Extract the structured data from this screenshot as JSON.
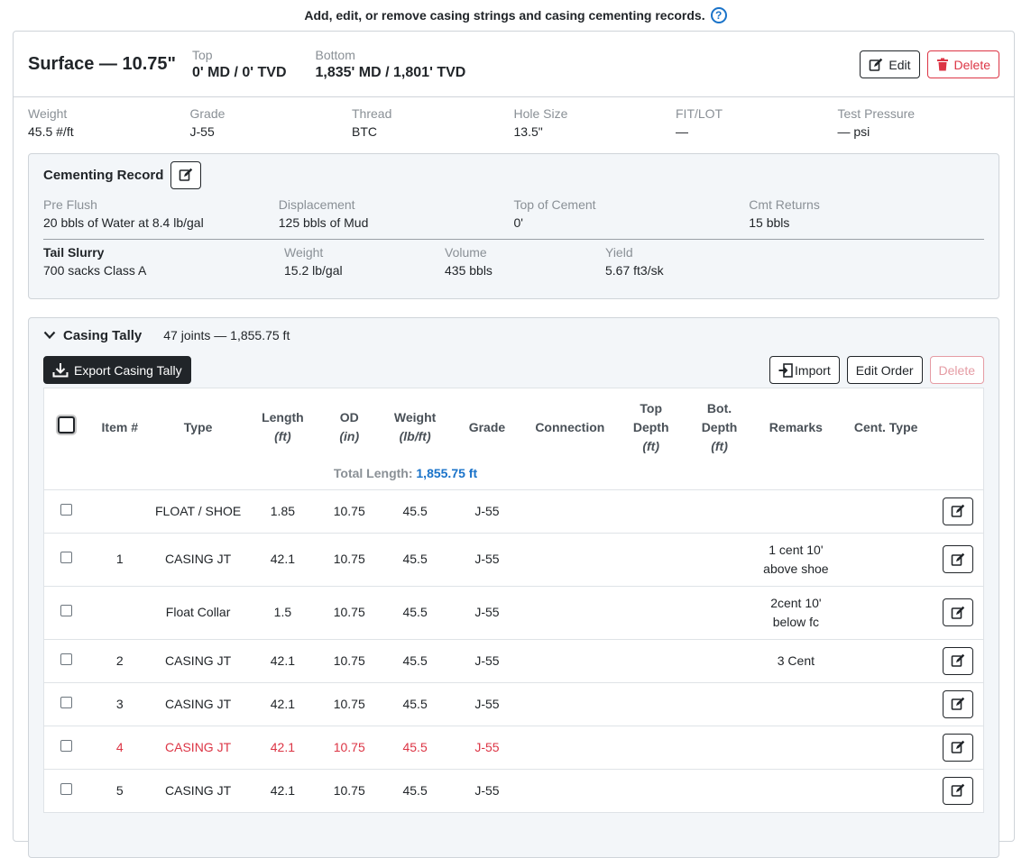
{
  "top_note": "Add, edit, or remove casing strings and casing cementing records.",
  "header": {
    "title": "Surface — 10.75\"",
    "top_label": "Top",
    "top_value": "0' MD / 0' TVD",
    "bottom_label": "Bottom",
    "bottom_value": "1,835' MD / 1,801' TVD",
    "edit_label": "Edit",
    "delete_label": "Delete"
  },
  "props": [
    {
      "label": "Weight",
      "value": "45.5 #/ft"
    },
    {
      "label": "Grade",
      "value": "J-55"
    },
    {
      "label": "Thread",
      "value": "BTC"
    },
    {
      "label": "Hole Size",
      "value": "13.5\""
    },
    {
      "label": "FIT/LOT",
      "value": "—"
    },
    {
      "label": "Test Pressure",
      "value": "— psi"
    }
  ],
  "cementing": {
    "title": "Cementing Record",
    "fields": [
      {
        "label": "Pre Flush",
        "value": "20 bbls of Water at 8.4 lb/gal"
      },
      {
        "label": "Displacement",
        "value": "125 bbls of Mud"
      },
      {
        "label": "Top of Cement",
        "value": "0'"
      },
      {
        "label": "Cmt Returns",
        "value": "15 bbls"
      }
    ],
    "tail": {
      "title": "Tail Slurry",
      "desc": "700 sacks  Class A",
      "fields": [
        {
          "label": "Weight",
          "value": "15.2 lb/gal"
        },
        {
          "label": "Volume",
          "value": "435 bbls"
        },
        {
          "label": "Yield",
          "value": "5.67 ft3/sk"
        }
      ]
    }
  },
  "tally": {
    "title": "Casing Tally",
    "summary": "47 joints — 1,855.75 ft",
    "export_label": "Export Casing Tally",
    "import_label": "Import",
    "edit_order_label": "Edit Order",
    "delete_label": "Delete",
    "columns": {
      "item": "Item #",
      "type": "Type",
      "length": "Length",
      "length_unit": "(ft)",
      "od": "OD",
      "od_unit": "(in)",
      "weight": "Weight",
      "weight_unit": "(lb/ft)",
      "grade": "Grade",
      "connection": "Connection",
      "top_depth_1": "Top",
      "top_depth_2": "Depth",
      "top_unit": "(ft)",
      "bot_depth_1": "Bot.",
      "bot_depth_2": "Depth",
      "bot_unit": "(ft)",
      "remarks": "Remarks",
      "cent_type": "Cent. Type"
    },
    "total_label": "Total Length:",
    "total_value": "1,855.75 ft",
    "rows": [
      {
        "item": "",
        "type": "FLOAT / SHOE",
        "length": "1.85",
        "od": "10.75",
        "weight": "45.5",
        "grade": "J-55",
        "remarks_1": "",
        "remarks_2": "",
        "highlight": false
      },
      {
        "item": "1",
        "type": "CASING JT",
        "length": "42.1",
        "od": "10.75",
        "weight": "45.5",
        "grade": "J-55",
        "remarks_1": "1 cent 10'",
        "remarks_2": "above shoe",
        "highlight": false
      },
      {
        "item": "",
        "type": "Float Collar",
        "length": "1.5",
        "od": "10.75",
        "weight": "45.5",
        "grade": "J-55",
        "remarks_1": "2cent 10'",
        "remarks_2": "below fc",
        "highlight": false
      },
      {
        "item": "2",
        "type": "CASING JT",
        "length": "42.1",
        "od": "10.75",
        "weight": "45.5",
        "grade": "J-55",
        "remarks_1": "3 Cent",
        "remarks_2": "",
        "highlight": false
      },
      {
        "item": "3",
        "type": "CASING JT",
        "length": "42.1",
        "od": "10.75",
        "weight": "45.5",
        "grade": "J-55",
        "remarks_1": "",
        "remarks_2": "",
        "highlight": false
      },
      {
        "item": "4",
        "type": "CASING JT",
        "length": "42.1",
        "od": "10.75",
        "weight": "45.5",
        "grade": "J-55",
        "remarks_1": "",
        "remarks_2": "",
        "highlight": true
      },
      {
        "item": "5",
        "type": "CASING JT",
        "length": "42.1",
        "od": "10.75",
        "weight": "45.5",
        "grade": "J-55",
        "remarks_1": "",
        "remarks_2": "",
        "highlight": false
      }
    ]
  },
  "colors": {
    "accent": "#1a73c9",
    "danger": "#dc3545",
    "panel": "#f3f6f9"
  }
}
